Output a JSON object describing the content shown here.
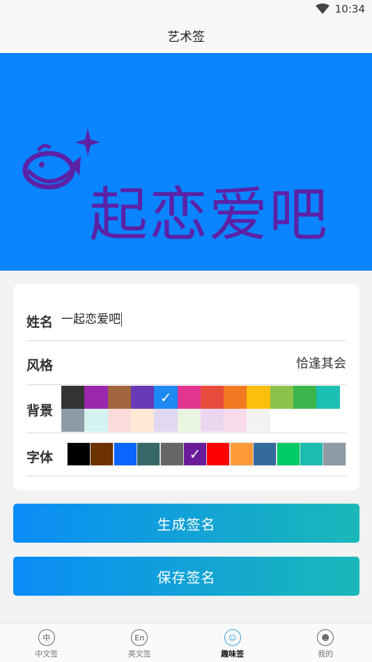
{
  "status": {
    "time": "10:34"
  },
  "header": {
    "title": "艺术签"
  },
  "preview": {
    "signature_text": "起恋爱吧",
    "background": "#0a84ff",
    "text_color": "#5b22a6"
  },
  "form": {
    "name_label": "姓名",
    "name_value": "一起恋爱吧",
    "style_label": "风格",
    "style_value": "恰逢其会",
    "bg_label": "背景",
    "font_label": "字体",
    "bg_colors": [
      "#333333",
      "#9b27af",
      "#a0643f",
      "#673ab7",
      "#1e88f5",
      "#e2358f",
      "#e74c3c",
      "#f27a22",
      "#fdbf0e",
      "#8bc34a",
      "#3bb44b",
      "#1cbfb3",
      "#8c9ba5",
      "#d4f2ef",
      "#fbdcda",
      "#fde8d6",
      "#e1d8f2",
      "#e9f5e0",
      "#ecd6ef",
      "#f9dbea",
      "#f2f2f2"
    ],
    "bg_selected_index": 4,
    "font_colors": [
      "#000000",
      "#6b3200",
      "#0a66ff",
      "#376767",
      "#666666",
      "#6a1b9a",
      "#ff0000",
      "#fd9a38",
      "#356a9c",
      "#00cc66",
      "#1abdb0",
      "#8c9ba5"
    ],
    "font_selected_index": 5
  },
  "buttons": {
    "generate": "生成签名",
    "save": "保存签名"
  },
  "tabs": [
    {
      "label": "中文签",
      "icon_text": "中",
      "icon": "chinese-sign-icon"
    },
    {
      "label": "英文签",
      "icon_text": "En",
      "icon": "english-sign-icon"
    },
    {
      "label": "趣味签",
      "icon_text": "☺",
      "icon": "fun-sign-icon",
      "active": true
    },
    {
      "label": "我的",
      "icon_text": "☻",
      "icon": "profile-icon"
    }
  ]
}
